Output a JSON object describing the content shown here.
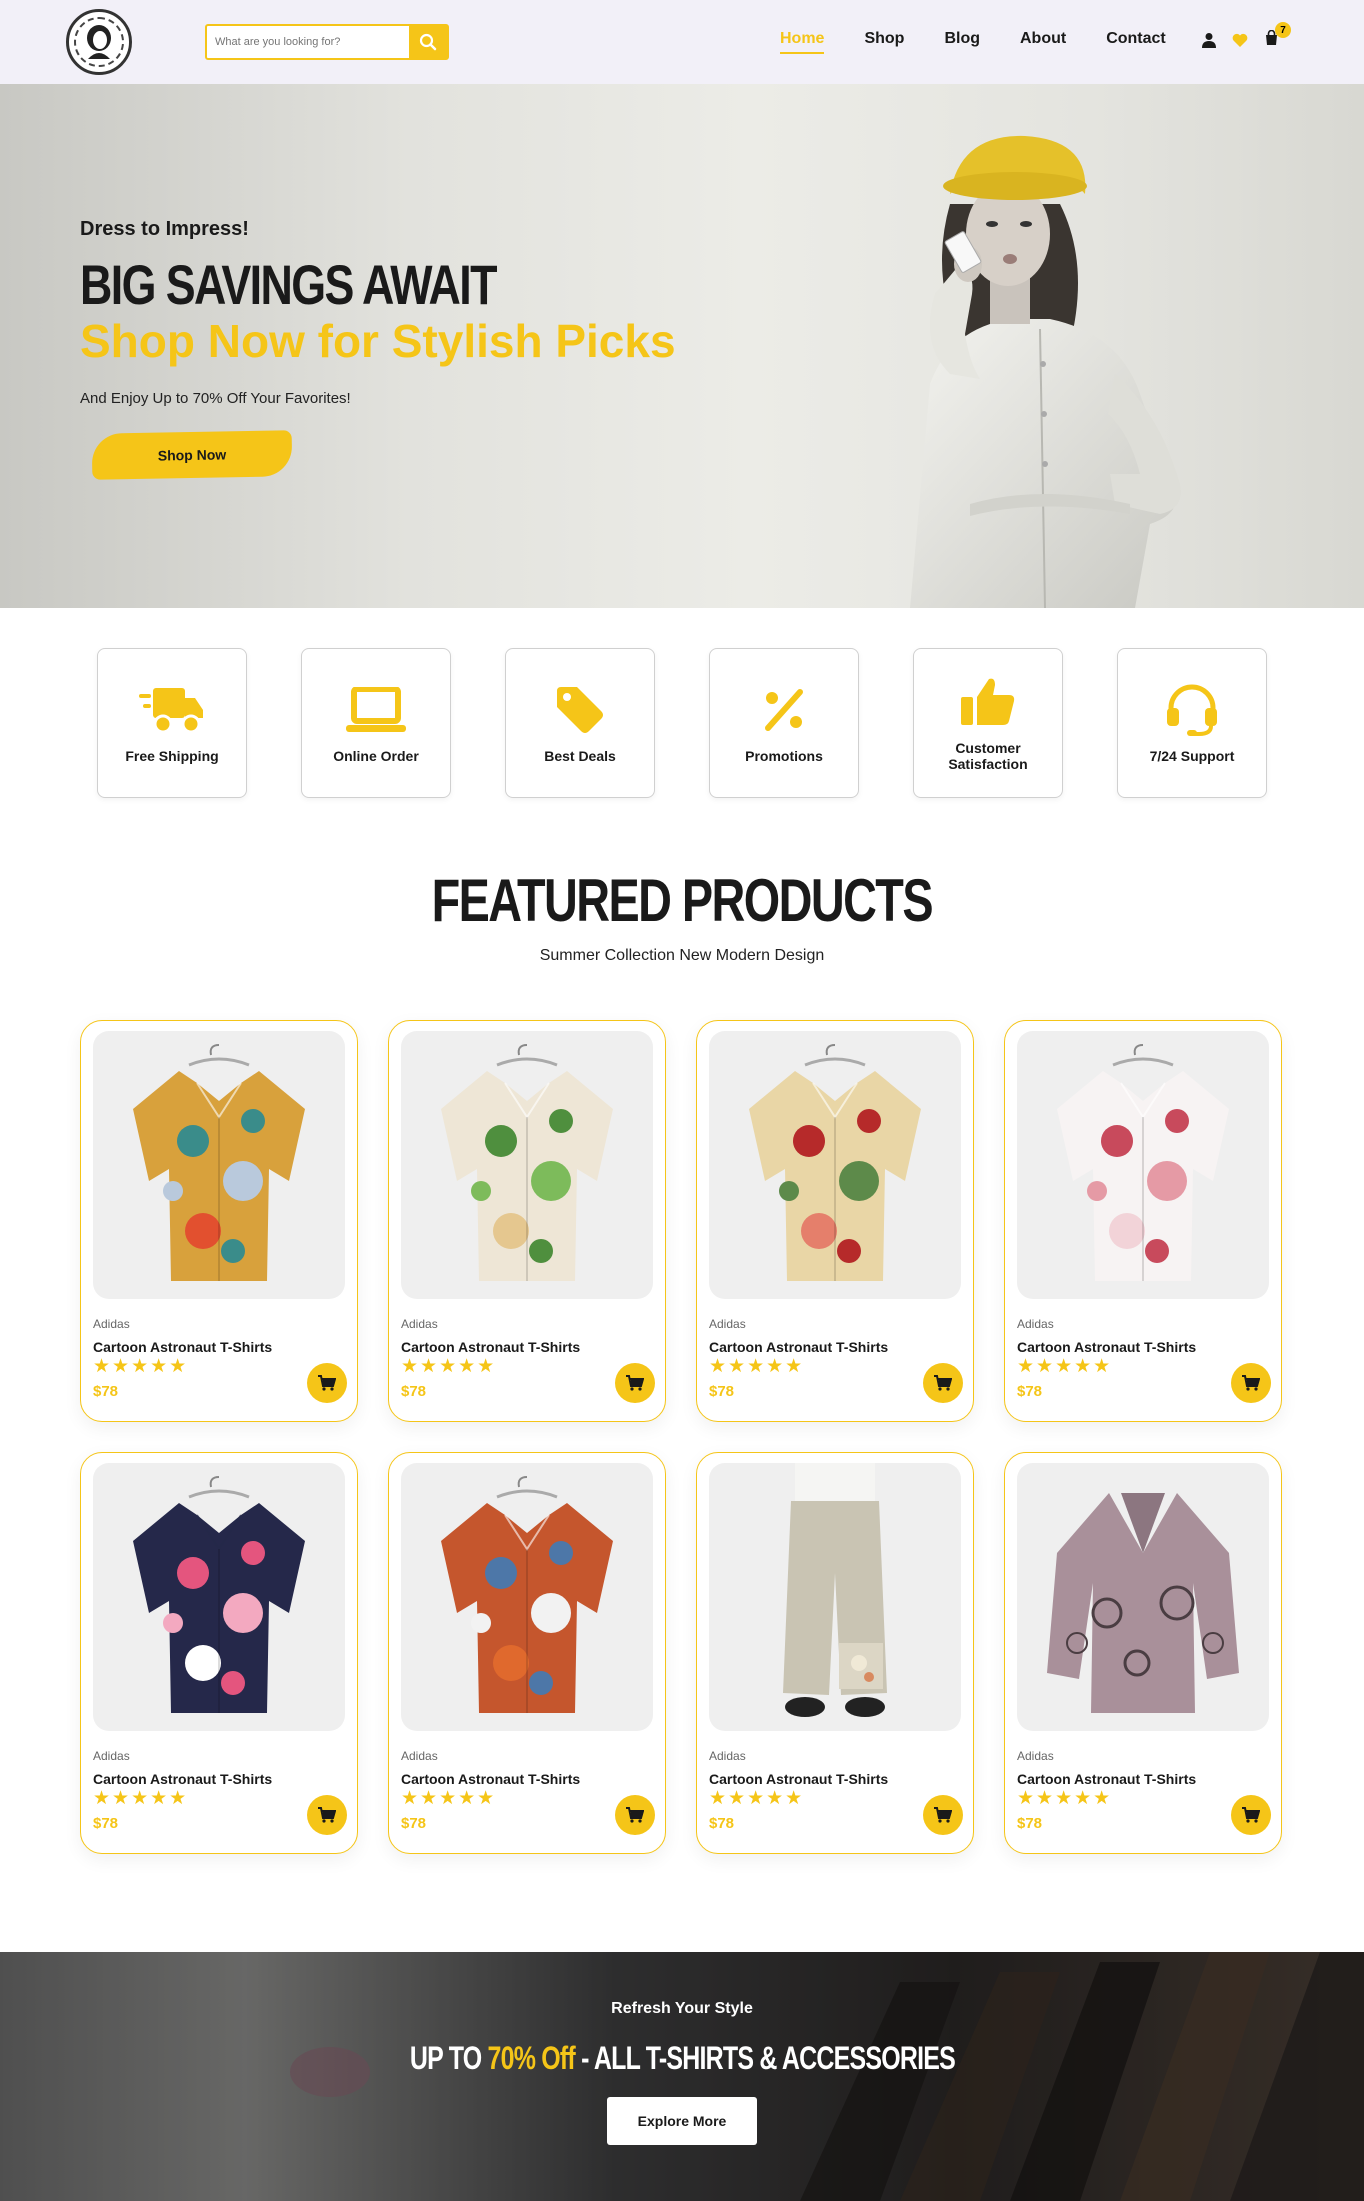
{
  "header": {
    "search_placeholder": "What are you looking for?",
    "nav": [
      {
        "label": "Home",
        "active": true
      },
      {
        "label": "Shop"
      },
      {
        "label": "Blog"
      },
      {
        "label": "About"
      },
      {
        "label": "Contact"
      }
    ],
    "cart_count": "7",
    "icons": [
      "user-icon",
      "heart-icon",
      "cart-icon"
    ],
    "accent": "#f5c518"
  },
  "hero": {
    "kicker": "Dress to Impress!",
    "title": "BIG SAVINGS AWAIT",
    "subtitle": "Shop Now for Stylish Picks",
    "description": "And Enjoy Up to 70% Off Your Favorites!",
    "button": "Shop Now"
  },
  "features": [
    {
      "label": "Free Shipping",
      "icon": "truck-icon"
    },
    {
      "label": "Online Order",
      "icon": "laptop-icon"
    },
    {
      "label": "Best Deals",
      "icon": "tag-icon"
    },
    {
      "label": "Promotions",
      "icon": "percent-icon"
    },
    {
      "label": "Customer Satisfaction",
      "icon": "thumbs-up-icon"
    },
    {
      "label": "7/24 Support",
      "icon": "headset-icon"
    }
  ],
  "featured": {
    "title": "FEATURED PRODUCTS",
    "subtitle": "Summer Collection New Modern Design",
    "products": [
      {
        "brand": "Adidas",
        "name": "Cartoon Astronaut T-Shirts",
        "stars": "★★★★★",
        "price": "$78",
        "image": "shirt-teal-floral"
      },
      {
        "brand": "Adidas",
        "name": "Cartoon Astronaut T-Shirts",
        "stars": "★★★★★",
        "price": "$78",
        "image": "shirt-green-leaves"
      },
      {
        "brand": "Adidas",
        "name": "Cartoon Astronaut T-Shirts",
        "stars": "★★★★★",
        "price": "$78",
        "image": "shirt-red-floral"
      },
      {
        "brand": "Adidas",
        "name": "Cartoon Astronaut T-Shirts",
        "stars": "★★★★★",
        "price": "$78",
        "image": "shirt-white-pink"
      },
      {
        "brand": "Adidas",
        "name": "Cartoon Astronaut T-Shirts",
        "stars": "★★★★★",
        "price": "$78",
        "image": "shirt-navy-floral"
      },
      {
        "brand": "Adidas",
        "name": "Cartoon Astronaut T-Shirts",
        "stars": "★★★★★",
        "price": "$78",
        "image": "shirt-orange-blue"
      },
      {
        "brand": "Adidas",
        "name": "Cartoon Astronaut T-Shirts",
        "stars": "★★★★★",
        "price": "$78",
        "image": "pants-linen"
      },
      {
        "brand": "Adidas",
        "name": "Cartoon Astronaut T-Shirts",
        "stars": "★★★★★",
        "price": "$78",
        "image": "blouse-mauve"
      }
    ]
  },
  "banner": {
    "kicker": "Refresh Your Style",
    "title_prefix": "UP TO ",
    "title_accent": "70% Off",
    "title_suffix": " - ALL T-SHIRTS & ACCESSORIES",
    "button": "Explore More"
  }
}
